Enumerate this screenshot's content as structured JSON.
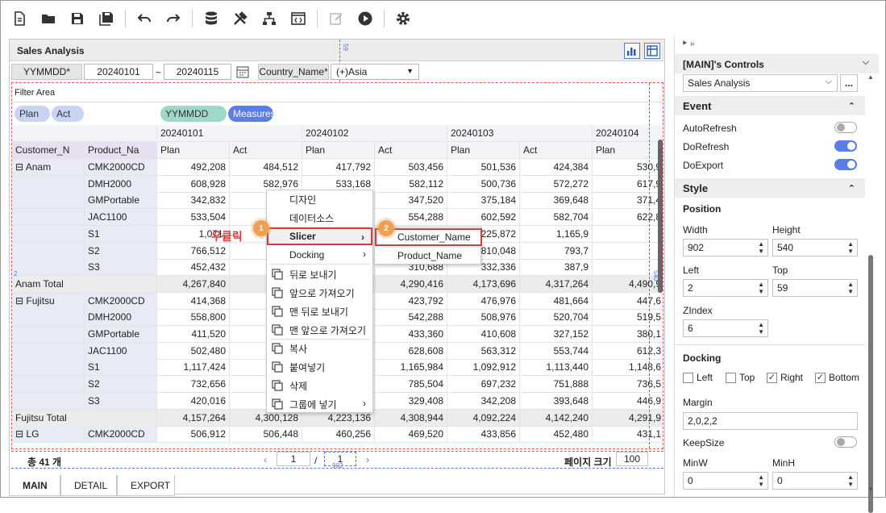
{
  "toolbar": {
    "icons": [
      "new-file",
      "open-folder",
      "save",
      "save-all",
      "undo",
      "redo",
      "database",
      "tools",
      "hierarchy",
      "code-view",
      "edit",
      "play",
      "settings"
    ]
  },
  "report": {
    "title": "Sales Analysis",
    "filter": {
      "date_label": "YYMMDD*",
      "date_from": "20240101",
      "tilde": "~",
      "date_to": "20240115",
      "country_label": "Country_Name*",
      "country_value": "(+)Asia"
    },
    "filter_area_label": "Filter Area",
    "row_chips": [
      "Plan",
      "Act"
    ],
    "col_chips": [
      "YYMMDD",
      "Measures"
    ],
    "row_headers": [
      "Customer_N",
      "Product_Na"
    ],
    "dates": [
      "20240101",
      "20240102",
      "20240103",
      "20240104"
    ],
    "measures": [
      "Plan",
      "Act",
      "Plan",
      "Act",
      "Plan",
      "Act",
      "Plan"
    ],
    "rows": [
      {
        "cust": "⊟ Anam",
        "prod": "CMK2000CD",
        "vals": [
          "492,208",
          "484,512",
          "417,792",
          "503,456",
          "501,536",
          "424,384",
          "530,9"
        ]
      },
      {
        "cust": "",
        "prod": "DMH2000",
        "vals": [
          "608,928",
          "582,976",
          "533,168",
          "582,112",
          "500,736",
          "572,272",
          "617,9"
        ]
      },
      {
        "cust": "",
        "prod": "GMPortable",
        "vals": [
          "342,832",
          "",
          "",
          "347,520",
          "375,184",
          "369,648",
          "371,4"
        ]
      },
      {
        "cust": "",
        "prod": "JAC1100",
        "vals": [
          "533,504",
          "",
          "",
          "554,288",
          "602,592",
          "582,704",
          "622,8"
        ]
      },
      {
        "cust": "",
        "prod": "S1",
        "vals": [
          "1,071,",
          "",
          "",
          "1,155,408",
          "1,225,872",
          "1,165,9",
          ""
        ]
      },
      {
        "cust": "",
        "prod": "S2",
        "vals": [
          "766,512",
          "",
          "",
          "727,552",
          "810,048",
          "793,7",
          ""
        ]
      },
      {
        "cust": "",
        "prod": "S3",
        "vals": [
          "452,432",
          "",
          "",
          "310,688",
          "332,336",
          "387,9",
          ""
        ]
      },
      {
        "cust": "Anam Total",
        "prod": "",
        "vals": [
          "4,267,840",
          "4,",
          "",
          "4,290,416",
          "4,173,696",
          "4,317,264",
          "4,490,9"
        ],
        "total": true
      },
      {
        "cust": "⊟ Fujitsu",
        "prod": "CMK2000CD",
        "vals": [
          "414,368",
          "",
          "",
          "423,792",
          "476,976",
          "481,664",
          "447,6"
        ]
      },
      {
        "cust": "",
        "prod": "DMH2000",
        "vals": [
          "558,800",
          "",
          "",
          "542,288",
          "508,976",
          "520,704",
          "519,5"
        ]
      },
      {
        "cust": "",
        "prod": "GMPortable",
        "vals": [
          "411,520",
          "",
          "",
          "433,360",
          "410,608",
          "327,152",
          "380,1"
        ]
      },
      {
        "cust": "",
        "prod": "JAC1100",
        "vals": [
          "502,480",
          "",
          "",
          "628,608",
          "563,312",
          "553,744",
          "612,3"
        ]
      },
      {
        "cust": "",
        "prod": "S1",
        "vals": [
          "1,117,424",
          "1",
          "",
          "1,165,984",
          "1,092,912",
          "1,113,440",
          "1,148,6"
        ]
      },
      {
        "cust": "",
        "prod": "S2",
        "vals": [
          "732,656",
          "",
          "",
          "785,504",
          "697,232",
          "751,888",
          "736,5"
        ]
      },
      {
        "cust": "",
        "prod": "S3",
        "vals": [
          "420,016",
          "",
          "",
          "329,408",
          "342,208",
          "393,648",
          "446,9"
        ]
      },
      {
        "cust": "Fujitsu Total",
        "prod": "",
        "vals": [
          "4,157,264",
          "4,300,128",
          "4,223,136",
          "4,308,944",
          "4,092,224",
          "4,142,240",
          "4,291,9"
        ],
        "total": true
      },
      {
        "cust": "⊟ LG",
        "prod": "CMK2000CD",
        "vals": [
          "506,912",
          "506,448",
          "460,256",
          "469,520",
          "433,856",
          "452,480",
          "431,1"
        ]
      }
    ],
    "pager": {
      "total": "총  41 개",
      "page": "1",
      "slash": "/",
      "pages": "1",
      "page_size_label": "페이지 크기",
      "page_size": "100",
      "small_label": "902"
    },
    "guide_labels": {
      "top": "59",
      "side": "540",
      "left_mark": "2"
    }
  },
  "context_menu": {
    "items": [
      "디자인",
      "데이터소스",
      "Slicer",
      "Docking",
      "뒤로 보내기",
      "앞으로 가져오기",
      "맨 뒤로 보내기",
      "맨 앞으로 가져오기",
      "복사",
      "붙여넣기",
      "삭제",
      "그룹에 넣기"
    ],
    "annotation": "우클릭",
    "badge1": "1",
    "badge2": "2",
    "submenu": [
      "Customer_Name",
      "Product_Name"
    ]
  },
  "tabs": [
    "MAIN",
    "DETAIL",
    "EXPORT"
  ],
  "panel": {
    "title": "[MAIN]'s Controls",
    "control_select": "Sales Analysis",
    "more": "...",
    "event_section": "Event",
    "auto_refresh": "AutoRefresh",
    "do_refresh": "DoRefresh",
    "do_export": "DoExport",
    "style_section": "Style",
    "position_label": "Position",
    "width_label": "Width",
    "width_value": "902",
    "height_label": "Height",
    "height_value": "540",
    "left_label": "Left",
    "left_value": "2",
    "top_label": "Top",
    "top_value": "59",
    "zindex_label": "ZIndex",
    "zindex_value": "6",
    "docking_label": "Docking",
    "dock_left": "Left",
    "dock_top": "Top",
    "dock_right": "Right",
    "dock_bottom": "Bottom",
    "margin_label": "Margin",
    "margin_value": "2,0,2,2",
    "keepsize_label": "KeepSize",
    "minw_label": "MinW",
    "minw_value": "0",
    "minh_label": "MinH",
    "minh_value": "0",
    "pin": "⯈ »"
  },
  "colors": {
    "accent": "#4a6fd8",
    "toggle_on": "#5b7de8",
    "row_chip": "#c9d3f3",
    "date_chip": "#9ed8c8",
    "measure_chip": "#5b7de8",
    "highlight": "#d93a3a"
  }
}
